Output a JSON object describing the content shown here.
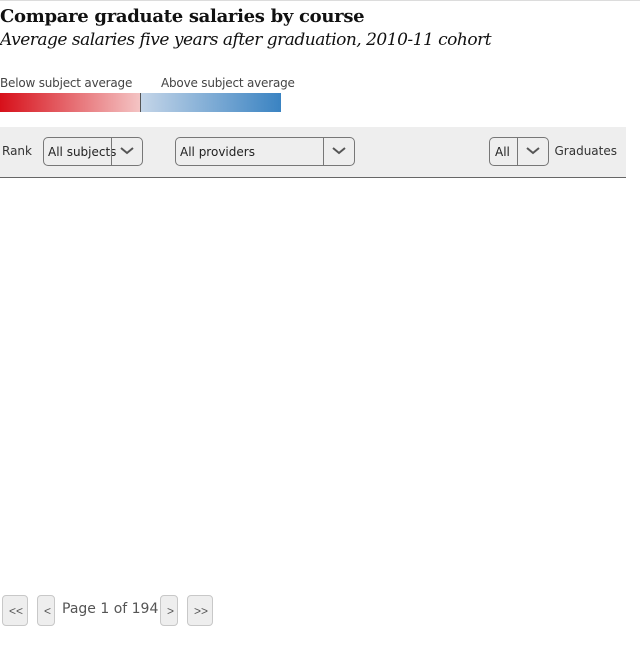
{
  "header": {
    "title": "Compare graduate salaries by course",
    "subtitle": "Average salaries five years after graduation, 2010-11 cohort"
  },
  "legend": {
    "below_label": "Below subject average",
    "above_label": "Above subject average",
    "below_color_start": "#d7101a",
    "below_color_end": "#f4c4c4",
    "above_color_start": "#c4d5e8",
    "above_color_end": "#3a83c2"
  },
  "filters": {
    "rank_label": "Rank",
    "subject_select": {
      "value": "All subjects"
    },
    "provider_select": {
      "value": "All providers"
    },
    "graduates_select": {
      "value": "All"
    },
    "graduates_label": "Graduates"
  },
  "pagination": {
    "first_label": "<<",
    "prev_label": "<",
    "status": "Page 1 of 194",
    "current_page": 1,
    "total_pages": 194,
    "next_label": ">",
    "last_label": ">>"
  },
  "icons": {
    "dropdown": "chevron-down-icon"
  }
}
